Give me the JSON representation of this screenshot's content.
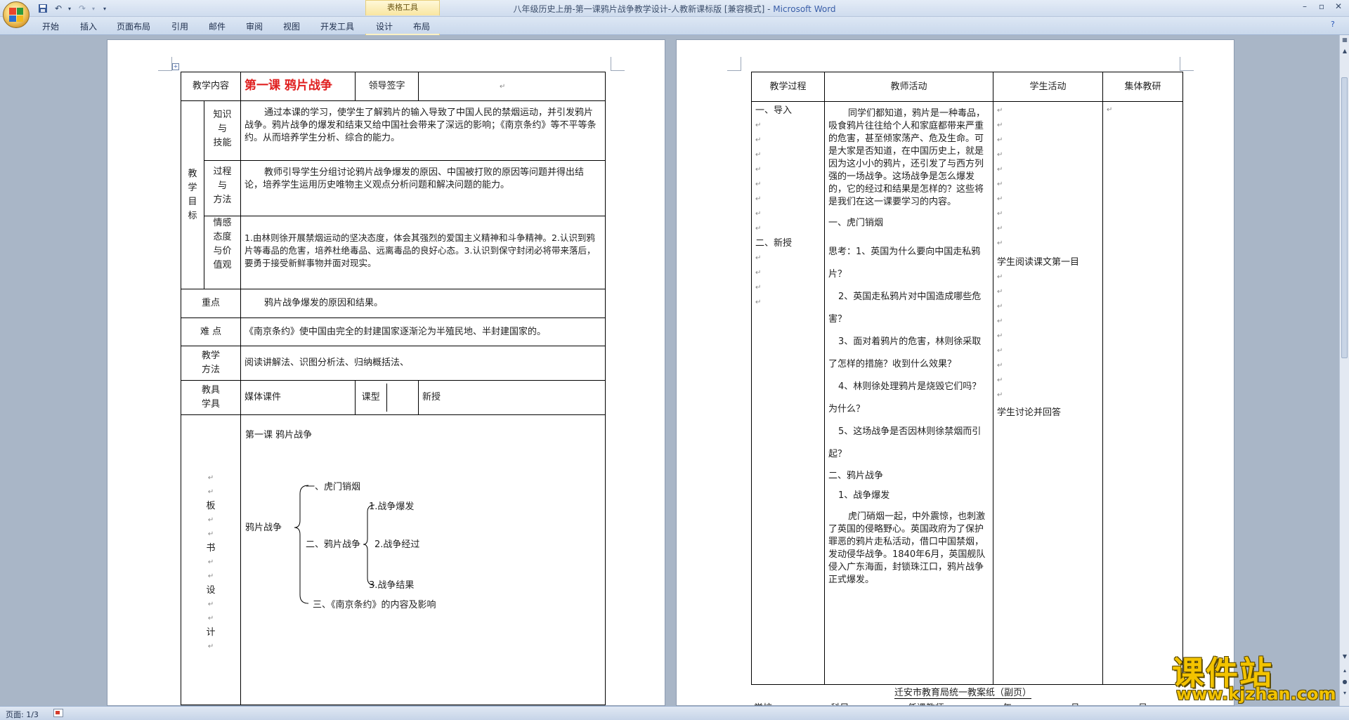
{
  "window": {
    "title": "八年级历史上册-第一课鸦片战争教学设计-人教新课标版 [兼容模式] - ",
    "app_name": "Microsoft Word",
    "context_tab_group": "表格工具"
  },
  "ribbon": {
    "tabs": [
      "开始",
      "插入",
      "页面布局",
      "引用",
      "邮件",
      "审阅",
      "视图",
      "开发工具",
      "设计",
      "布局"
    ]
  },
  "page1": {
    "header_row": {
      "label": "教学内容",
      "title": "第一课    鸦片战争",
      "leader_sign": "领导签字"
    },
    "goals_label": [
      "教",
      "学",
      "目",
      "标"
    ],
    "goals": [
      {
        "sub_label": [
          "知识",
          "与",
          "技能"
        ],
        "text": "通过本课的学习，使学生了解鸦片的输入导致了中国人民的禁烟运动，并引发鸦片战争。鸦片战争的爆发和结束又给中国社会带来了深远的影响；《南京条约》等不平等条约。从而培养学生分析、综合的能力。"
      },
      {
        "sub_label": [
          "过程",
          "与",
          "方法"
        ],
        "text": "教师引导学生分组讨论鸦片战争爆发的原因、中国被打败的原因等问题并得出结论，培养学生运用历史唯物主义观点分析问题和解决问题的能力。"
      },
      {
        "sub_label": [
          "情感",
          "态度",
          "与价",
          "值观"
        ],
        "text": "1.由林则徐开展禁烟运动的坚决态度，体会其强烈的爱国主义精神和斗争精神。2.认识到鸦片等毒品的危害，培养杜绝毒品、远离毒品的良好心态。3.认识到保守封闭必将带来落后，要勇于接受新鲜事物并面对现实。"
      }
    ],
    "key_point": {
      "label": "重点",
      "text": "鸦片战争爆发的原因和结果。"
    },
    "difficulty": {
      "label": "难 点",
      "text": "《南京条约》使中国由完全的封建国家逐渐沦为半殖民地、半封建国家的。"
    },
    "method": {
      "label": [
        "教学",
        "方法"
      ],
      "text": "阅读讲解法、识图分析法、归纳概括法、"
    },
    "tools": {
      "label": [
        "教具",
        "学具"
      ],
      "text": "媒体课件",
      "type_label": "课型",
      "type_value": "新授"
    },
    "board": {
      "label": [
        "板",
        "书",
        "设",
        "计"
      ],
      "title": "第一课   鸦片战争",
      "root": "鸦片战争",
      "item1": "一、虎门销烟",
      "item2": "二、鸦片战争",
      "item3": "三、《南京条约》的内容及影响",
      "sub1": "1.战争爆发",
      "sub2": "2.战争经过",
      "sub3": "3.战争结果"
    }
  },
  "page2": {
    "headers": [
      "教学过程",
      "教师活动",
      "学生活动",
      "集体教研"
    ],
    "process": [
      "一、导入",
      "二、新授"
    ],
    "teacher": {
      "intro": "同学们都知道，鸦片是一种毒品，吸食鸦片往往给个人和家庭都带来严重的危害，甚至倾家荡产、危及生命。可是大家是否知道，在中国历史上，就是因为这小小的鸦片，还引发了与西方列强的一场战争。这场战争是怎么爆发的，它的经过和结果是怎样的？这些将是我们在这一课要学习的内容。",
      "sec1": "一、虎门销烟",
      "q1": "思考：1、英国为什么要向中国走私鸦片？",
      "q2": "2、英国走私鸦片对中国造成哪些危害？",
      "q3": "3、面对着鸦片的危害，林则徐采取了怎样的措施？收到什么效果？",
      "q4": "4、林则徐处理鸦片是烧毁它们吗？为什么？",
      "q5": "5、这场战争是否因林则徐禁烟而引起？",
      "sec2": "二、鸦片战争",
      "sub1": "1、战争爆发",
      "para": "虎门硝烟一起，中外震惊，也刺激了英国的侵略野心。英国政府为了保护罪恶的鸦片走私活动，借口中国禁烟，发动侵华战争。1840年6月，英国舰队侵入广东海面，封锁珠江口，鸦片战争正式爆发。"
    },
    "student": [
      "学生阅读课文第一目",
      "学生讨论并回答"
    ],
    "footer": "迁安市教育局统一教案纸（副页）",
    "footer_row": [
      "学校",
      "科目",
      "任课教师",
      "年",
      "月",
      "日"
    ]
  },
  "watermark": {
    "text": "课件站",
    "url": "www.kjzhan.com"
  },
  "status": {
    "page": "页面: 1/3"
  }
}
